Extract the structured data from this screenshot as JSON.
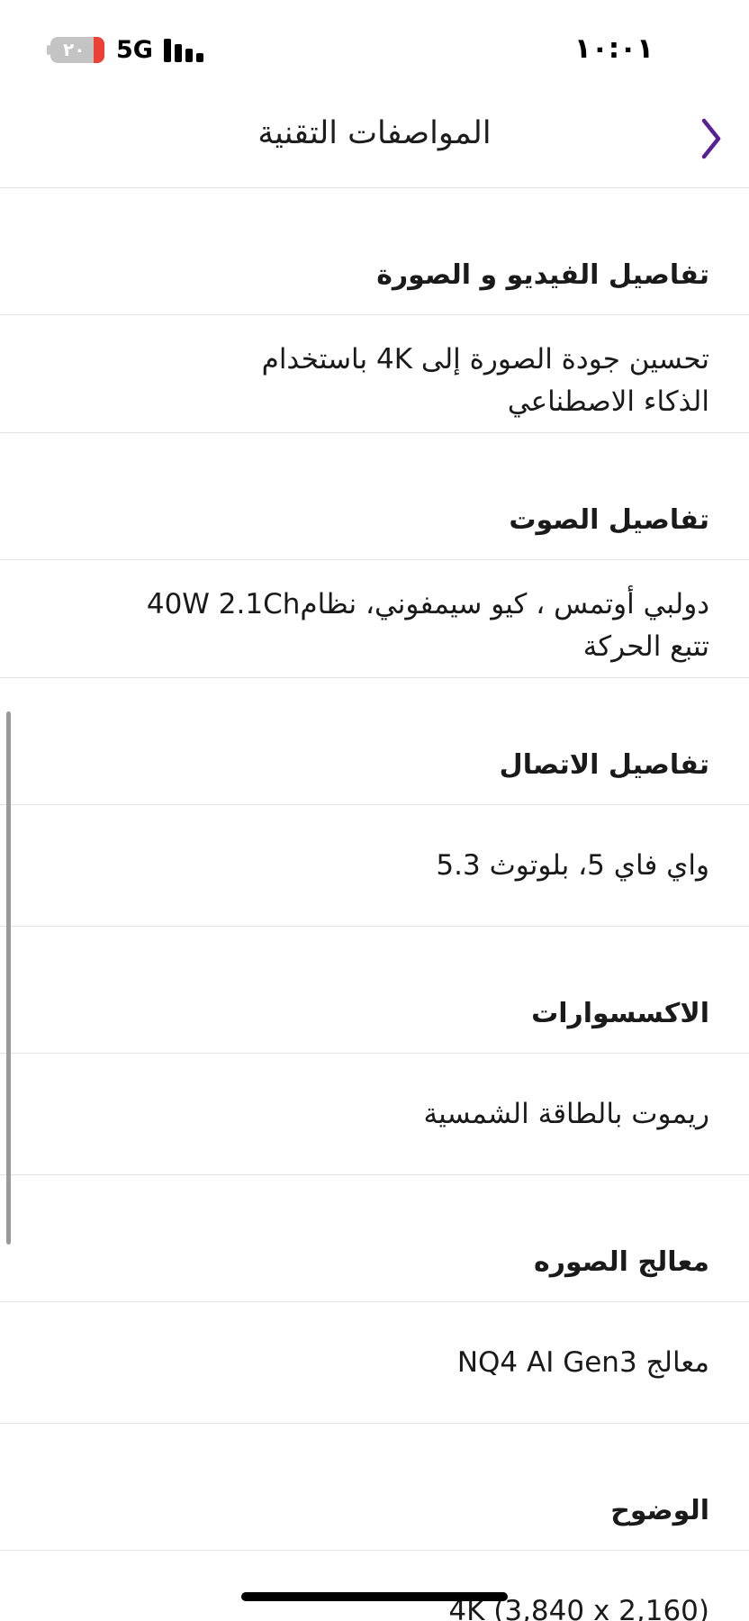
{
  "status_bar": {
    "time": "١٠:٠١",
    "network": "5G",
    "battery_label": "٢٠",
    "battery_level": 0.2,
    "signal_icon": "signal-bars-icon",
    "battery_color": "#eb4034"
  },
  "header": {
    "title": "المواصفات التقنية",
    "back_icon": "chevron-right-icon",
    "accent_color": "#5a1e96"
  },
  "specs": [
    {
      "label": "تفاصيل الفيديو و الصورة",
      "value_line1": "تحسين جودة الصورة إلى 4K باستخدام",
      "value_line2": "الذكاء الاصطناعي"
    },
    {
      "label": "تفاصيل الصوت",
      "value_line1": "دولبي أوتمس ، كيو سيمفوني، نظام40W 2.1Ch",
      "value_line2": "تتبع الحركة"
    },
    {
      "label": "تفاصيل الاتصال",
      "value": "واي فاي 5، بلوتوث 5.3"
    },
    {
      "label": "الاكسسوارات",
      "value": "ريموت بالطاقة الشمسية"
    },
    {
      "label": "معالج الصوره",
      "value": "معالج NQ4 AI Gen3"
    },
    {
      "label": "الوضوح",
      "value": "4K (3,840 x 2,160)"
    }
  ]
}
